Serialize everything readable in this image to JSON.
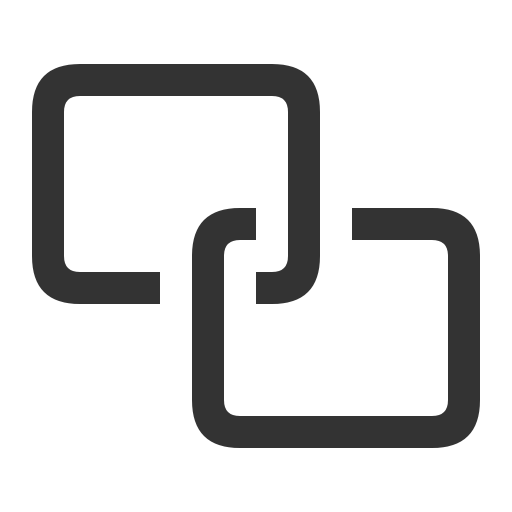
{
  "icon": {
    "name": "link-icon",
    "color": "#333333",
    "background": "#ffffff"
  }
}
